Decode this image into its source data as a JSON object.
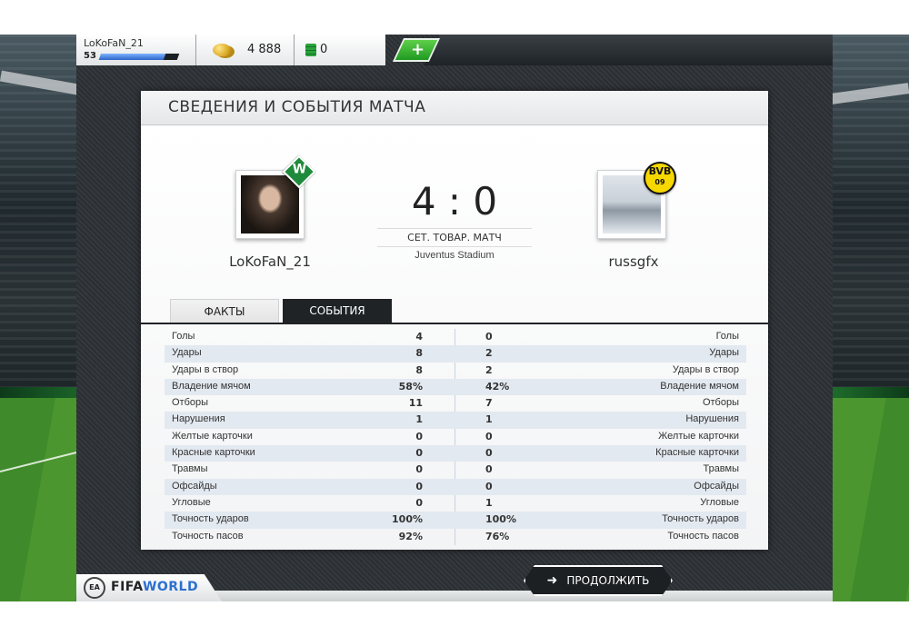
{
  "topbar": {
    "username": "LoKoFaN_21",
    "level": "53",
    "xp_progress_fraction": 0.82,
    "coins": "4 888",
    "points": "0",
    "add_label": "+"
  },
  "panel": {
    "title": "СВЕДЕНИЯ И СОБЫТИЯ МАТЧА",
    "home": {
      "name": "LoKoFaN_21",
      "badge": "W"
    },
    "away": {
      "name": "russgfx",
      "badge_top": "BVB",
      "badge_bottom": "09"
    },
    "score": "4 : 0",
    "match_type": "СЕТ. ТОВАР. МАТЧ",
    "stadium": "Juventus Stadium"
  },
  "tabs": {
    "facts": "ФАКТЫ",
    "events": "СОБЫТИЯ"
  },
  "stats": [
    {
      "label": "Голы",
      "home": "4",
      "away": "0"
    },
    {
      "label": "Удары",
      "home": "8",
      "away": "2"
    },
    {
      "label": "Удары в створ",
      "home": "8",
      "away": "2"
    },
    {
      "label": "Владение мячом",
      "home": "58%",
      "away": "42%"
    },
    {
      "label": "Отборы",
      "home": "11",
      "away": "7"
    },
    {
      "label": "Нарушения",
      "home": "1",
      "away": "1"
    },
    {
      "label": "Желтые карточки",
      "home": "0",
      "away": "0"
    },
    {
      "label": "Красные карточки",
      "home": "0",
      "away": "0"
    },
    {
      "label": "Травмы",
      "home": "0",
      "away": "0"
    },
    {
      "label": "Офсайды",
      "home": "0",
      "away": "0"
    },
    {
      "label": "Угловые",
      "home": "0",
      "away": "1"
    },
    {
      "label": "Точность ударов",
      "home": "100%",
      "away": "100%"
    },
    {
      "label": "Точность пасов",
      "home": "92%",
      "away": "76%"
    }
  ],
  "bottombar": {
    "ea_label": "EA",
    "brand_fifa": "FIFA",
    "brand_world": "WORLD",
    "continue_label": "ПРОДОЛЖИТЬ",
    "continue_icon": "arrow-right-icon"
  }
}
